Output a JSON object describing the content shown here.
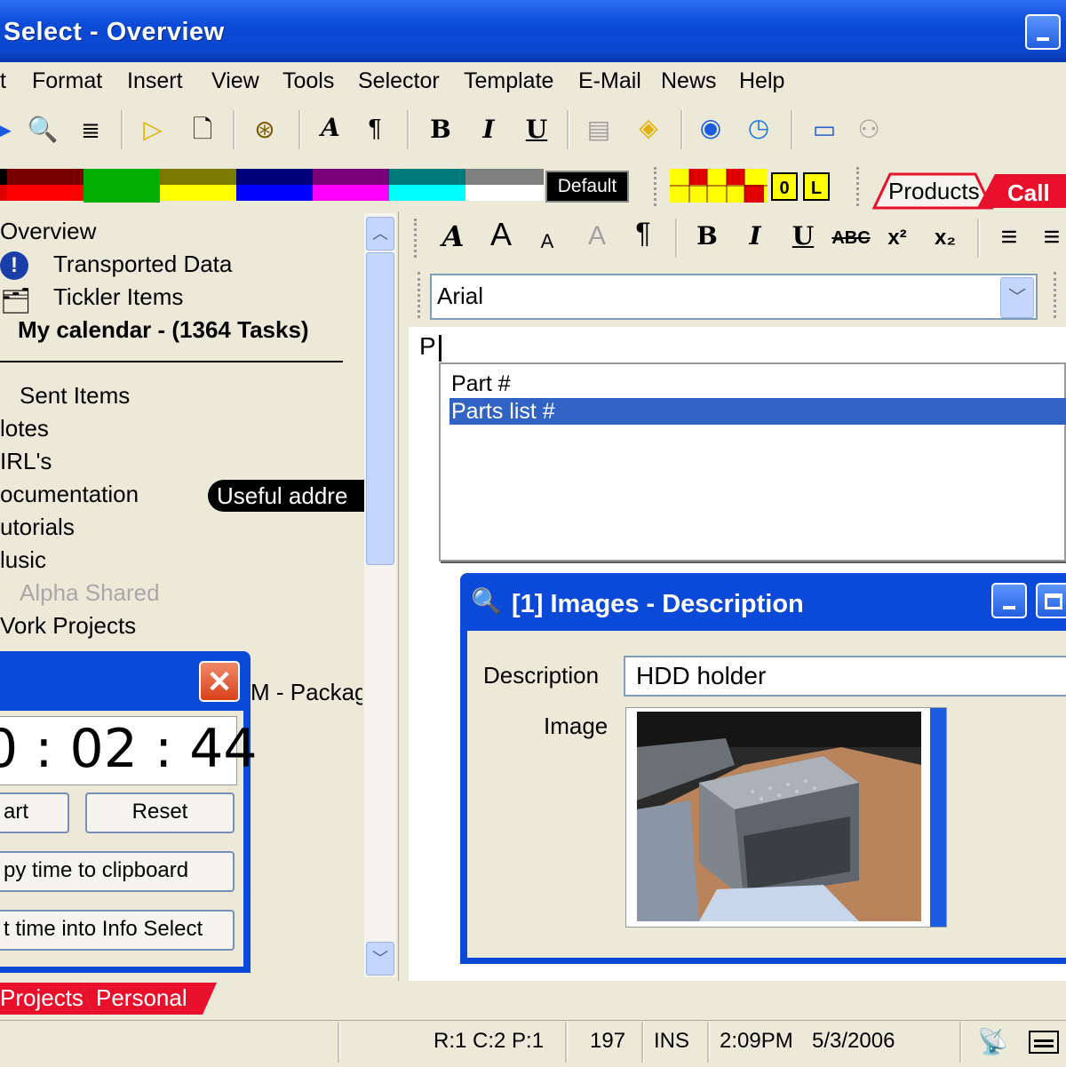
{
  "window": {
    "title": "Select - Overview"
  },
  "menu": [
    "t",
    "Format",
    "Insert",
    "View",
    "Tools",
    "Selector",
    "Template",
    "E-Mail",
    "News",
    "Help"
  ],
  "palette": {
    "default_label": "Default",
    "o_label": "0",
    "l_label": "L"
  },
  "top_tabs": {
    "products": "Products",
    "call": "Call"
  },
  "tree": {
    "root": "Overview",
    "items": [
      "Transported Data",
      "Tickler Items"
    ],
    "calendar": "My calendar - (1364 Tasks)",
    "sent": "Sent Items",
    "folders": [
      "lotes",
      "IRL's",
      "ocumentation",
      "utorials",
      "lusic"
    ],
    "useful": "Useful addre",
    "alpha": "Alpha Shared",
    "work": "Vork Projects",
    "package_partial": "M - Packag"
  },
  "editor": {
    "font_value": "Arial",
    "typed_text": "P",
    "autocomplete": [
      "Part #",
      "Parts list #"
    ],
    "selected_index": 1
  },
  "timer": {
    "time": "0 : 02 : 44",
    "start_label": "art",
    "reset_label": "Reset",
    "copy_label": "py time to clipboard",
    "insert_label": "t time into Info Select"
  },
  "images_window": {
    "title": "[1] Images - Description",
    "description_label": "Description",
    "description_value": "HDD holder",
    "image_label": "Image"
  },
  "bottom_tabs": [
    "Projects",
    "Personal"
  ],
  "status": {
    "position": "R:1 C:2 P:1",
    "count": "197",
    "mode": "INS",
    "time": "2:09PM",
    "date": "5/3/2006"
  },
  "colors": {
    "xp_blue": "#0b4ad8",
    "tab_red": "#e8102a",
    "selection": "#3163c5"
  }
}
